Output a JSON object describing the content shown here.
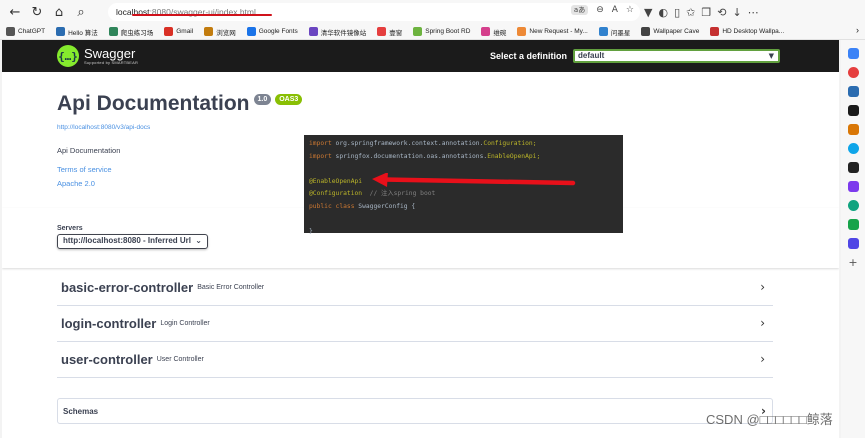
{
  "browser": {
    "url_host": "localhost",
    "url_path": ":8080/swagger-ui/index.html",
    "addr_aa": "aあ",
    "bookmarks": [
      {
        "label": "ChatGPT",
        "color": "#555555"
      },
      {
        "label": "Hello 算法",
        "color": "#2b6cb0"
      },
      {
        "label": "爬虫练习场",
        "color": "#2f855a"
      },
      {
        "label": "Gmail",
        "color": "#d93025"
      },
      {
        "label": "浏览网",
        "color": "#c27c0e"
      },
      {
        "label": "Google Fonts",
        "color": "#1a73e8"
      },
      {
        "label": "清华软件镜像站",
        "color": "#6b46c1"
      },
      {
        "label": "壹窗",
        "color": "#e53e3e"
      },
      {
        "label": "Spring Boot RD",
        "color": "#6db33f"
      },
      {
        "label": "维碗",
        "color": "#d53f8c"
      },
      {
        "label": "New Request - My...",
        "color": "#ed8936"
      },
      {
        "label": "问墨星",
        "color": "#3182ce"
      },
      {
        "label": "Wallpaper Cave",
        "color": "#444444"
      },
      {
        "label": "HD Desktop Wallpa...",
        "color": "#c53030"
      }
    ],
    "bookmarks_more": "›"
  },
  "swagger": {
    "logo_title": "Swagger",
    "logo_sub": "Supported by SMARTBEAR",
    "definition_label": "Select a definition",
    "definition_value": "default",
    "api_title": "Api Documentation",
    "version_badge": "1.0",
    "oas_badge": "OAS3",
    "api_docs_url": "http://localhost:8080/v3/api-docs",
    "description": "Api Documentation",
    "terms_link": "Terms of service",
    "license_link": "Apache 2.0",
    "servers_label": "Servers",
    "servers_value": "http://localhost:8080 - Inferred Url",
    "tags": [
      {
        "name": "basic-error-controller",
        "desc": "Basic Error Controller"
      },
      {
        "name": "login-controller",
        "desc": "Login Controller"
      },
      {
        "name": "user-controller",
        "desc": "User Controller"
      }
    ],
    "schemas_label": "Schemas"
  },
  "code_overlay": {
    "line1_kw": "import",
    "line1_rest": " org.springframework.context.annotation.",
    "line1_cls": "Configuration;",
    "line2_kw": "import",
    "line2_rest": " springfox.documentation.oas.annotations.",
    "line2_cls": "EnableOpenApi;",
    "line3": "@EnableOpenApi",
    "line4_ann": "@Configuration",
    "line4_cmt": "  // 注入spring boot",
    "line5_kw": "public class",
    "line5_rest": " SwaggerConfig {",
    "line6": "}"
  },
  "watermark": "CSDN @□□□□□□鲸落",
  "colors": {
    "swagger_topbar": "#1b1b1b",
    "swagger_green": "#85ea2d",
    "link_blue": "#4990e2",
    "annotation_arrow": "#e8101a"
  }
}
